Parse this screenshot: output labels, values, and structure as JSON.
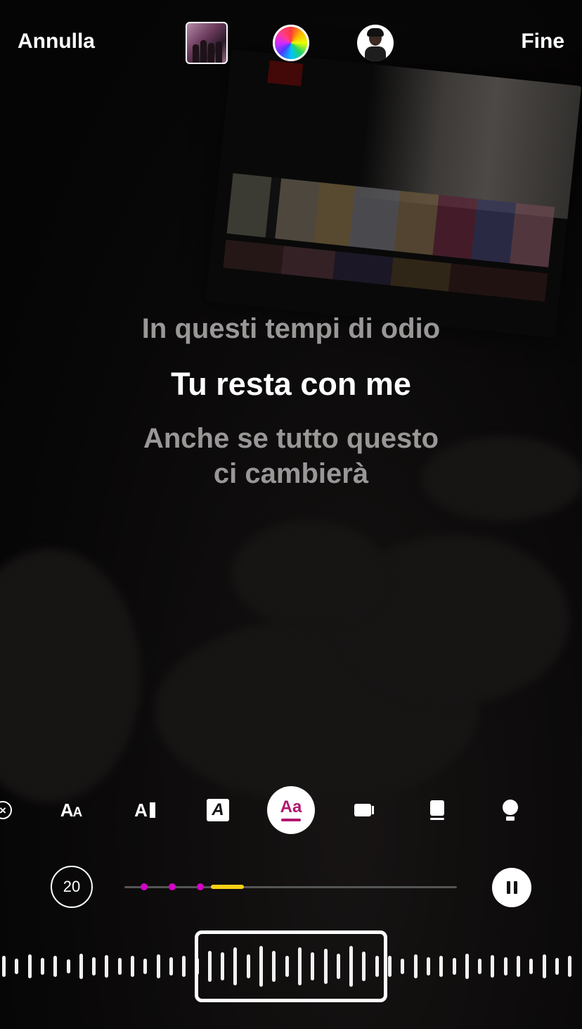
{
  "header": {
    "cancel_label": "Annulla",
    "done_label": "Fine"
  },
  "lyrics": {
    "previous": "In questi tempi di odio",
    "current": "Tu resta con me",
    "next_line1": "Anche se tutto questo",
    "next_line2": "ci cambierà"
  },
  "style_toolbar": {
    "items": [
      "close-icon",
      "text-size-icon",
      "text-background-icon",
      "italic-box-icon",
      "selected-style-icon",
      "camera-icon",
      "sticker-stand-icon",
      "lightbulb-icon"
    ],
    "selected_label": "Aa"
  },
  "player": {
    "duration": "20",
    "progress_highlight_start": 0.26,
    "progress_highlight_end": 0.36
  },
  "colors": {
    "accent": "#b0176f",
    "marker": "#d400c8",
    "highlight": "#f7d117"
  }
}
